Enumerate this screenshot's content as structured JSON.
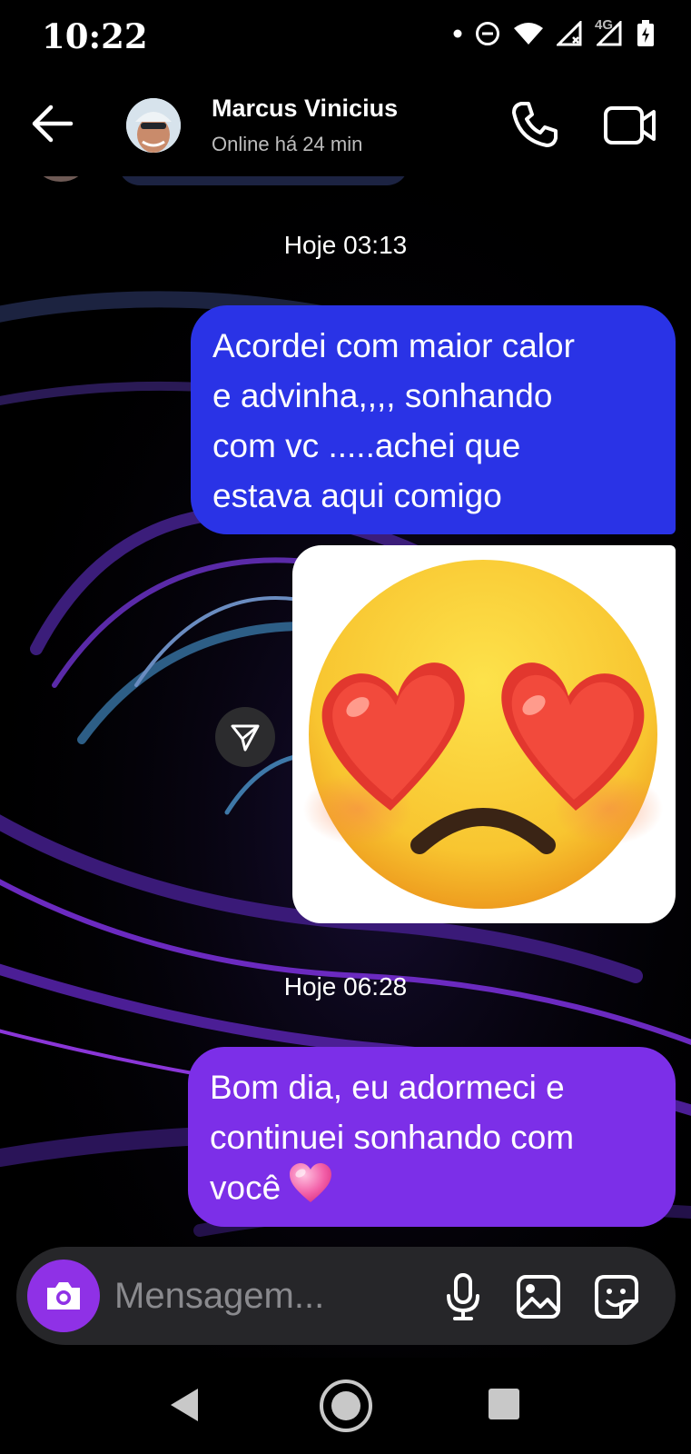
{
  "status_bar": {
    "time": "10:22",
    "network": "4G"
  },
  "header": {
    "contact_name": "Marcus Vinicius",
    "contact_status": "Online há 24 min"
  },
  "chat": {
    "messages": [
      {
        "type": "timestamp",
        "text": "Hoje 03:13"
      },
      {
        "type": "text",
        "direction": "sent",
        "text": "Acordei com maior calor\ne advinha,,,, sonhando\ncom vc .....achei que\nestava aqui comigo"
      },
      {
        "type": "image",
        "direction": "sent",
        "content": "heart-eyes frowning emoji"
      },
      {
        "type": "timestamp",
        "text": "Hoje 06:28"
      },
      {
        "type": "text",
        "direction": "sent",
        "text": "Bom dia, eu adormeci e\ncontinuei sonhando com\nvocê"
      }
    ]
  },
  "composer": {
    "placeholder": "Mensagem..."
  },
  "colors": {
    "bubble_blue": "#2a33e6",
    "bubble_purple": "#7c2fe8",
    "camera_button": "#8f31e6",
    "composer_bg": "#262629"
  },
  "icons": {
    "back": "arrow-left-icon",
    "call": "phone-icon",
    "video": "video-camera-icon",
    "share": "paper-plane-icon",
    "camera": "camera-icon",
    "mic": "microphone-icon",
    "gallery": "image-icon",
    "sticker": "sticker-icon"
  }
}
